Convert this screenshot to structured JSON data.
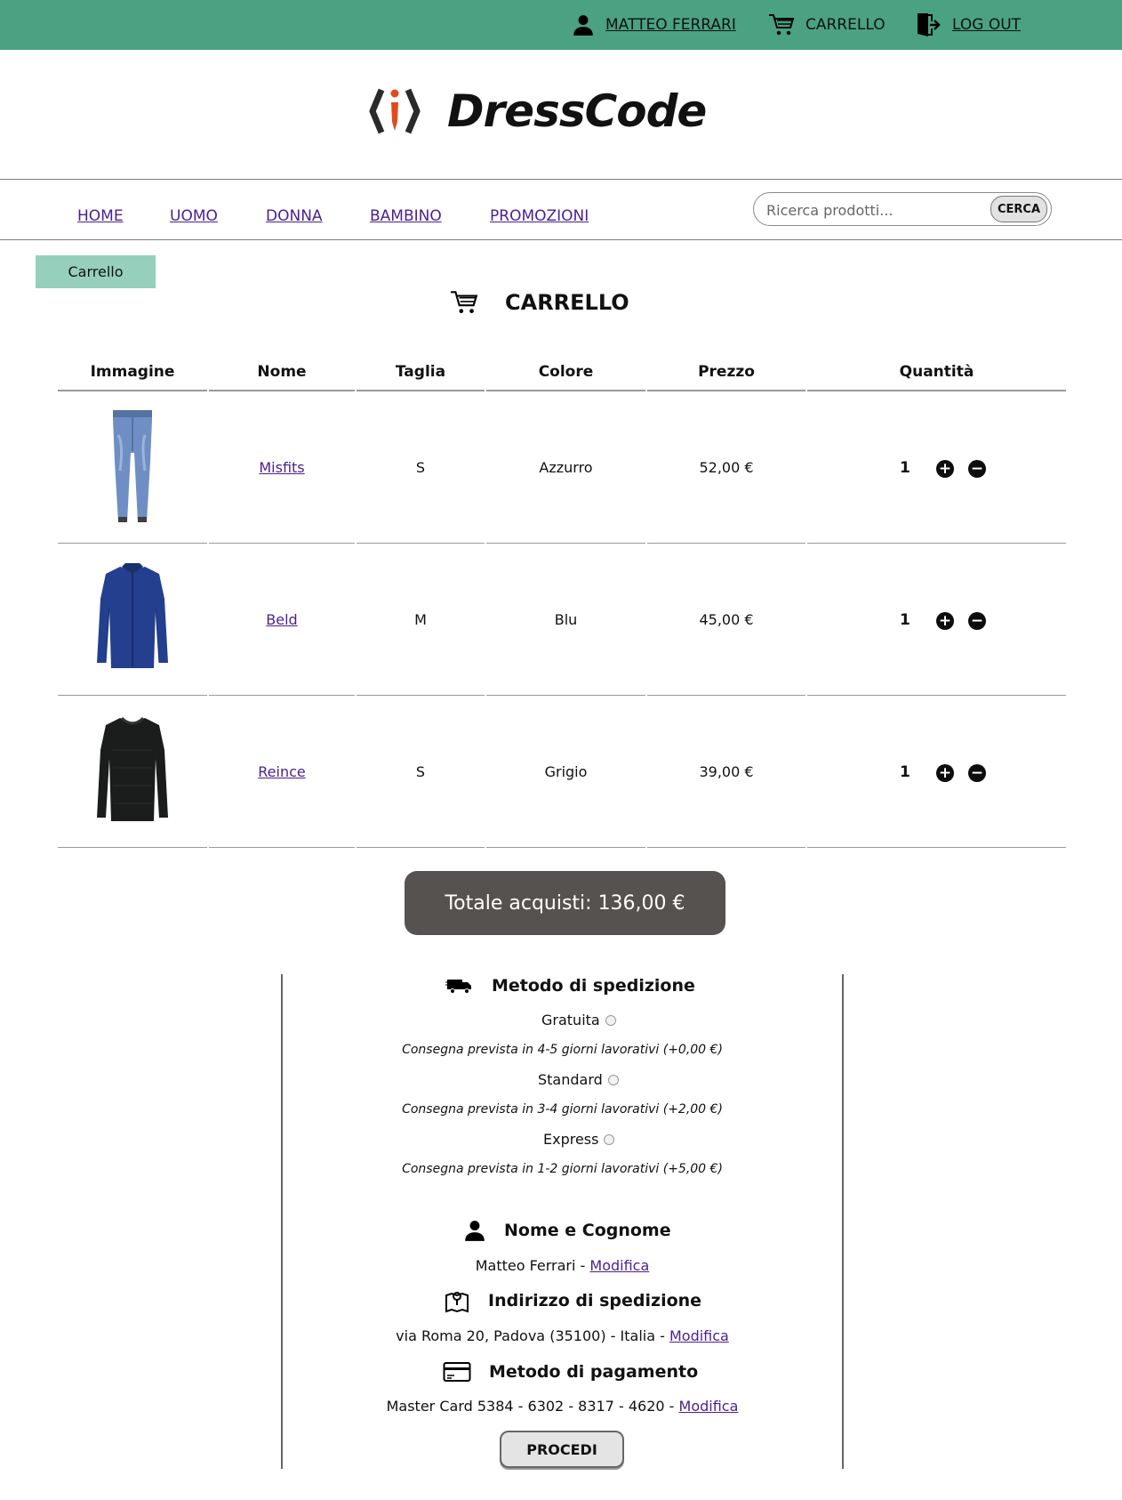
{
  "topbar": {
    "user_label": "MATTEO FERRARI",
    "cart_label": "CARRELLO",
    "logout_label": "LOG OUT",
    "bg_color": "#4aa283"
  },
  "brand": {
    "name": "DressCode"
  },
  "nav": {
    "links": [
      "HOME",
      "UOMO",
      "DONNA",
      "BAMBINO",
      "PROMOZIONI"
    ],
    "search_placeholder": "Ricerca prodotti...",
    "search_button": "CERCA"
  },
  "breadcrumb": {
    "current": "Carrello"
  },
  "page": {
    "title": "CARRELLO"
  },
  "table": {
    "headers": [
      "Immagine",
      "Nome",
      "Taglia",
      "Colore",
      "Prezzo",
      "Quantità"
    ],
    "rows": [
      {
        "image": "jeans",
        "name": "Misfits",
        "size": "S",
        "color": "Azzurro",
        "price": "52,00 €",
        "qty": "1"
      },
      {
        "image": "shirt",
        "name": "Beld",
        "size": "M",
        "color": "Blu",
        "price": "45,00 €",
        "qty": "1"
      },
      {
        "image": "sweater",
        "name": "Reince",
        "size": "S",
        "color": "Grigio",
        "price": "39,00 €",
        "qty": "1"
      }
    ]
  },
  "total": {
    "label": "Totale acquisti: 136,00 €"
  },
  "shipping": {
    "title": "Metodo di spedizione",
    "options": [
      {
        "label": "Gratuita",
        "note": "Consegna prevista in 4-5 giorni lavorativi (+0,00 €)"
      },
      {
        "label": "Standard",
        "note": "Consegna prevista in 3-4 giorni lavorativi (+2,00 €)"
      },
      {
        "label": "Express",
        "note": "Consegna prevista in 1-2 giorni lavorativi (+5,00 €)"
      }
    ]
  },
  "name_section": {
    "title": "Nome e Cognome",
    "value": "Matteo Ferrari - ",
    "edit": "Modifica"
  },
  "address_section": {
    "title": "Indirizzo di spedizione",
    "value": "via Roma 20, Padova (35100) - Italia - ",
    "edit": "Modifica"
  },
  "payment_section": {
    "title": "Metodo di pagamento",
    "value": "Master Card 5384 - 6302 - 8317 - 4620 - ",
    "edit": "Modifica"
  },
  "proceed_label": "PROCEDI",
  "icons": {
    "user": "user-icon",
    "cart": "cart-icon",
    "logout": "logout-icon",
    "truck": "truck-icon",
    "map": "map-pin-icon",
    "card": "credit-card-icon",
    "plus": "plus-circle-icon",
    "minus": "minus-circle-icon"
  }
}
